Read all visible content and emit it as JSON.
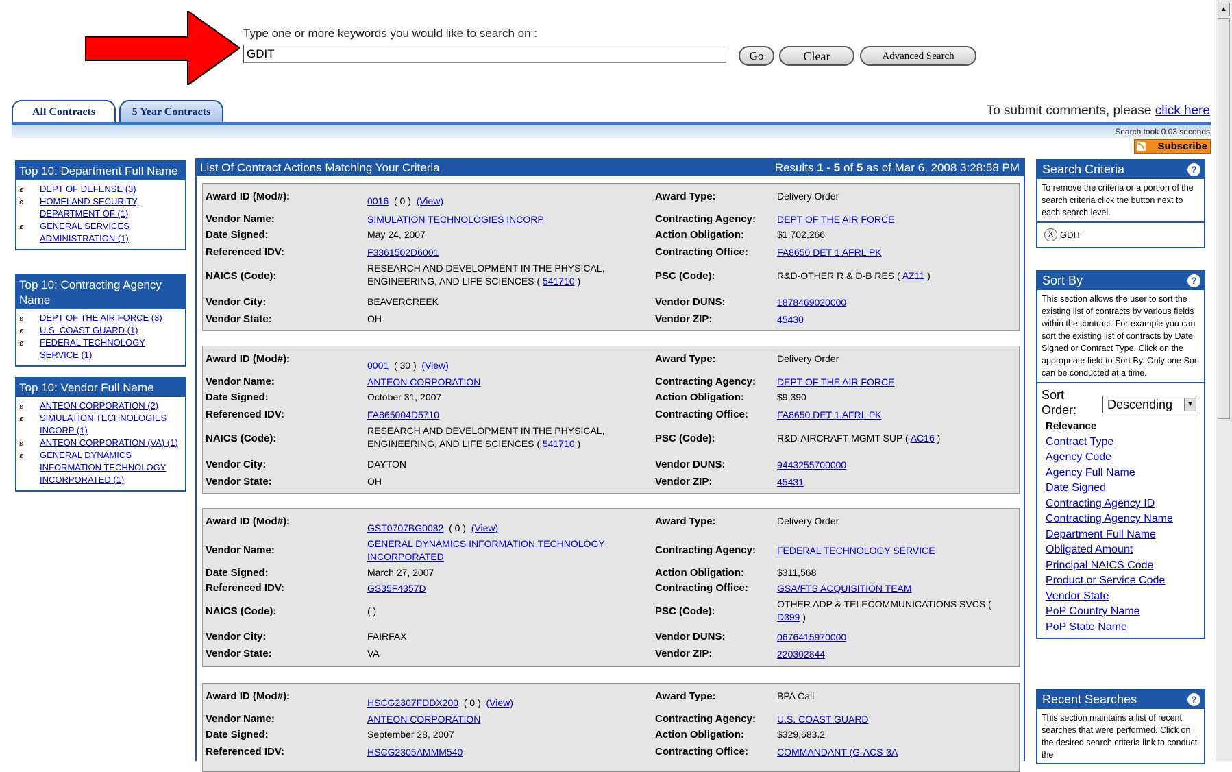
{
  "search": {
    "prompt": "Type one or more keywords you would like to search on :",
    "value": "GDIT",
    "go": "Go",
    "clear": "Clear",
    "advanced": "Advanced Search"
  },
  "tabs": {
    "all": "All Contracts",
    "five_year": "5 Year Contracts"
  },
  "comments": {
    "text": "To submit comments, please ",
    "link": "click here"
  },
  "search_time": "Search took 0.03 seconds",
  "subscribe": "Subscribe",
  "left_boxes": [
    {
      "title": "Top 10: Department Full Name",
      "items": [
        "DEPT OF DEFENSE (3)",
        "HOMELAND SECURITY, DEPARTMENT OF (1)",
        "GENERAL SERVICES ADMINISTRATION (1)"
      ]
    },
    {
      "title": "Top 10: Contracting Agency Name",
      "items": [
        "DEPT OF THE AIR FORCE (3)",
        "U.S. COAST GUARD (1)",
        "FEDERAL TECHNOLOGY SERVICE (1)"
      ]
    },
    {
      "title": "Top 10: Vendor Full Name",
      "items": [
        "ANTEON CORPORATION (2)",
        "SIMULATION TECHNOLOGIES INCORP (1)",
        "ANTEON CORPORATION (VA) (1)",
        "GENERAL DYNAMICS INFORMATION TECHNOLOGY INCORPORATED (1)"
      ]
    }
  ],
  "main": {
    "title": "List Of Contract Actions Matching Your Criteria",
    "results_prefix": "Results ",
    "results_from": "1",
    "results_sep": " - ",
    "results_to": "5",
    "results_of": " of ",
    "results_total": "5",
    "results_suffix": " as of Mar 6, 2008 3:28:58 PM"
  },
  "labels": {
    "award_id": "Award ID (Mod#):",
    "vendor_name": "Vendor Name:",
    "date_signed": "Date Signed:",
    "ref_idv": "Referenced IDV:",
    "naics": "NAICS (Code):",
    "vendor_city": "Vendor City:",
    "vendor_state": "Vendor State:",
    "award_type": "Award Type:",
    "agency": "Contracting Agency:",
    "obligation": "Action Obligation:",
    "office": "Contracting Office:",
    "psc": "PSC (Code):",
    "duns": "Vendor DUNS:",
    "zip": "Vendor ZIP:",
    "view": "(View)"
  },
  "records": [
    {
      "award_id": "0016",
      "mod": "( 0 )",
      "vendor_name": "SIMULATION TECHNOLOGIES INCORP",
      "date_signed": "May 24, 2007",
      "ref_idv": "F3361502D6001",
      "naics_text": "RESEARCH AND DEVELOPMENT IN THE PHYSICAL, ENGINEERING, AND LIFE SCIENCES ( ",
      "naics_code": "541710",
      "naics_close": " )",
      "vendor_city": "BEAVERCREEK",
      "vendor_state": "OH",
      "award_type": "Delivery Order",
      "agency": "DEPT OF THE AIR FORCE",
      "obligation": "$1,702,266",
      "office": "FA8650 DET 1 AFRL PK",
      "psc_text": "R&D-OTHER R & D-B RES ( ",
      "psc_code": "AZ11",
      "psc_close": " )",
      "duns": "1878469020000",
      "zip": "45430"
    },
    {
      "award_id": "0001",
      "mod": "( 30 )",
      "vendor_name": "ANTEON CORPORATION",
      "date_signed": "October 31, 2007",
      "ref_idv": "FA865004D5710",
      "naics_text": "RESEARCH AND DEVELOPMENT IN THE PHYSICAL, ENGINEERING, AND LIFE SCIENCES ( ",
      "naics_code": "541710",
      "naics_close": " )",
      "vendor_city": "DAYTON",
      "vendor_state": "OH",
      "award_type": "Delivery Order",
      "agency": "DEPT OF THE AIR FORCE",
      "obligation": "$9,390",
      "office": "FA8650 DET 1 AFRL PK",
      "psc_text": "R&D-AIRCRAFT-MGMT SUP ( ",
      "psc_code": "AC16",
      "psc_close": " )",
      "duns": "9443255700000",
      "zip": "45431"
    },
    {
      "award_id": "GST0707BG0082",
      "mod": "( 0 )",
      "vendor_name": "GENERAL DYNAMICS INFORMATION TECHNOLOGY INCORPORATED",
      "date_signed": "March 27, 2007",
      "ref_idv": "GS35F4357D",
      "naics_text": "( )",
      "naics_code": "",
      "naics_close": "",
      "vendor_city": "FAIRFAX",
      "vendor_state": "VA",
      "award_type": "Delivery Order",
      "agency": "FEDERAL TECHNOLOGY SERVICE",
      "obligation": "$311,568",
      "office": "GSA/FTS ACQUISITION TEAM",
      "psc_text": "OTHER ADP & TELECOMMUNICATIONS SVCS ( ",
      "psc_code": "D399",
      "psc_close": " )",
      "duns": "0676415970000",
      "zip": "220302844"
    },
    {
      "award_id": "HSCG2307FDDX200",
      "mod": "( 0 )",
      "vendor_name": "ANTEON CORPORATION",
      "date_signed": "September 28, 2007",
      "ref_idv": "HSCG2305AMMM540",
      "award_type": "BPA Call",
      "agency": "U.S. COAST GUARD",
      "obligation": "$329,683.2",
      "office": "COMMANDANT (G-ACS-3A"
    }
  ],
  "search_criteria": {
    "title": "Search Criteria",
    "desc": "To remove the criteria or a portion of the search criteria click the button next to each search level.",
    "chip_icon": "X",
    "chip": "GDIT"
  },
  "sort_by": {
    "title": "Sort By",
    "desc": "This section allows the user to sort the existing list of contracts by various fields within the contract. For example you can sort the existing list of contracts by Date Signed or Contract Type. Click on the appropriate field to Sort By. Only one Sort can be conducted at a time.",
    "sort_label": "Sort Order:",
    "sort_value": "Descending",
    "relevance": "Relevance",
    "fields": [
      "Contract Type",
      "Agency Code",
      "Agency Full Name",
      "Date Signed",
      "Contracting Agency ID",
      "Contracting Agency Name",
      "Department Full Name",
      "Obligated Amount",
      "Principal NAICS Code",
      "Product or Service Code",
      "Vendor State",
      "PoP Country Name",
      "PoP State Name"
    ]
  },
  "recent": {
    "title": "Recent Searches",
    "desc": "This section maintains a list of recent searches that were performed. Click on the desired search criteria link to conduct the"
  },
  "help_glyph": "?",
  "colors": {
    "brand_blue": "#1f58a6",
    "link": "#0000cc",
    "record_bg": "#e5e5e5",
    "arrow_red": "#ff0000",
    "subscribe": "#f08a1e"
  }
}
